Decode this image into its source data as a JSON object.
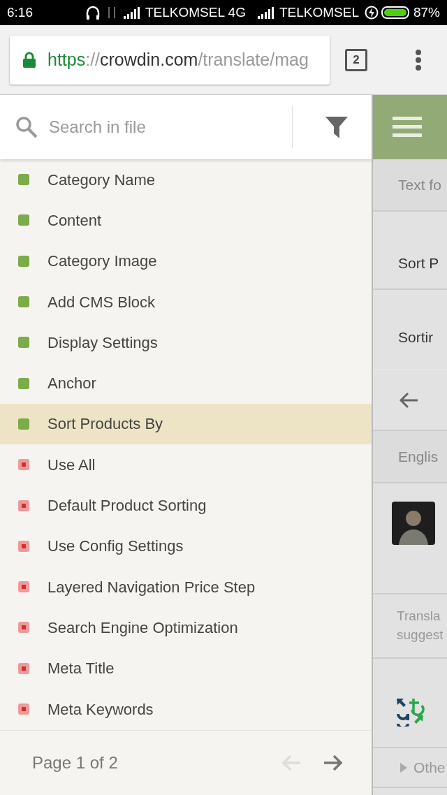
{
  "status_bar": {
    "time": "6:16",
    "carrier_1": "TELKOMSEL 4G",
    "carrier_2": "TELKOMSEL",
    "battery": "87%"
  },
  "browser": {
    "url": [
      {
        "text": "https",
        "kind": "secure"
      },
      {
        "text": "://",
        "kind": "muted"
      },
      {
        "text": "crowdin.com",
        "kind": "host"
      },
      {
        "text": "/translate/mag",
        "kind": "muted"
      }
    ],
    "tab_count": "2"
  },
  "search": {
    "placeholder": "Search in file"
  },
  "strings": [
    {
      "label": "Category Name",
      "kind": "done",
      "color": "#7cab4a",
      "selected": false
    },
    {
      "label": "Content",
      "kind": "done",
      "color": "#7cab4a",
      "selected": false
    },
    {
      "label": "Category Image",
      "kind": "done",
      "color": "#7cab4a",
      "selected": false
    },
    {
      "label": "Add CMS Block",
      "kind": "done",
      "color": "#7cab4a",
      "selected": false
    },
    {
      "label": "Display Settings",
      "kind": "done",
      "color": "#7cab4a",
      "selected": false
    },
    {
      "label": "Anchor",
      "kind": "done",
      "color": "#7cab4a",
      "selected": false
    },
    {
      "label": "Sort Products By",
      "kind": "done",
      "color": "#7cab4a",
      "selected": true
    },
    {
      "label": "Use All",
      "kind": "todo",
      "color": "#ef9a9a",
      "selected": false
    },
    {
      "label": "Default Product Sorting",
      "kind": "todo",
      "color": "#ef9a9a",
      "selected": false
    },
    {
      "label": "Use Config Settings",
      "kind": "todo",
      "color": "#ef9a9a",
      "selected": false
    },
    {
      "label": "Layered Navigation Price Step",
      "kind": "todo",
      "color": "#ef9a9a",
      "selected": false
    },
    {
      "label": "Search Engine Optimization",
      "kind": "todo",
      "color": "#ef9a9a",
      "selected": false
    },
    {
      "label": "Meta Title",
      "kind": "todo",
      "color": "#ef9a9a",
      "selected": false
    },
    {
      "label": "Meta Keywords",
      "kind": "todo",
      "color": "#ef9a9a",
      "selected": false
    }
  ],
  "pagination": {
    "label": "Page 1 of 2",
    "prev_disabled": true,
    "next_disabled": false
  },
  "editor": [
    {
      "kind": "menu"
    },
    {
      "kind": "label",
      "text": "Text fo"
    },
    {
      "kind": "source",
      "text": "Sort P"
    },
    {
      "kind": "translation",
      "text": "Sortir"
    },
    {
      "kind": "back"
    },
    {
      "kind": "label",
      "text": "Englis"
    },
    {
      "kind": "avatar"
    },
    {
      "kind": "label2",
      "lines": [
        "Transla",
        "suggest"
      ]
    },
    {
      "kind": "machine"
    },
    {
      "kind": "expander",
      "text": "Othe"
    }
  ]
}
